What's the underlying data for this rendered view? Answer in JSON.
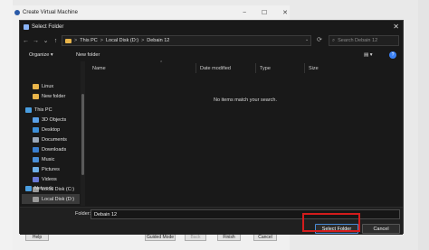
{
  "vm_window": {
    "title": "Create Virtual Machine",
    "min_glyph": "−",
    "max_glyph": "☐",
    "close_glyph": "✕",
    "buttons": {
      "help": "Help",
      "guided_mode": "Guided Mode",
      "back": "Back",
      "finish": "Finish",
      "cancel": "Cancel"
    }
  },
  "dialog": {
    "title": "Select Folder",
    "close_glyph": "✕",
    "nav": {
      "back": "←",
      "forward": "→",
      "dropdown": "⌄",
      "up": "↑",
      "refresh": "⟳"
    },
    "breadcrumb": [
      "This PC",
      "Local Disk (D:)",
      "Debain 12"
    ],
    "breadcrumb_sep": ">",
    "search_placeholder": "Search Debain 12",
    "search_glyph": "⌕",
    "organize": "Organize ▾",
    "new_folder": "New folder",
    "view_glyph": "▤ ▾",
    "help_glyph": "?",
    "sidebar": [
      {
        "label": "Linux",
        "icon": "folder-icon",
        "color": "#e8b44a"
      },
      {
        "label": "New folder",
        "icon": "folder-icon",
        "color": "#e8b44a"
      },
      {
        "label": "This PC",
        "icon": "computer-icon",
        "color": "#4a9ee0"
      },
      {
        "label": "3D Objects",
        "icon": "cube-icon",
        "color": "#5aa0e6"
      },
      {
        "label": "Desktop",
        "icon": "desktop-icon",
        "color": "#3d8fd8"
      },
      {
        "label": "Documents",
        "icon": "documents-icon",
        "color": "#9aa7b8"
      },
      {
        "label": "Downloads",
        "icon": "download-icon",
        "color": "#3a7fd0"
      },
      {
        "label": "Music",
        "icon": "music-icon",
        "color": "#4a8fd8"
      },
      {
        "label": "Pictures",
        "icon": "pictures-icon",
        "color": "#6fb0e8"
      },
      {
        "label": "Videos",
        "icon": "videos-icon",
        "color": "#6a7ad8"
      },
      {
        "label": "Local Disk (C:)",
        "icon": "drive-icon",
        "color": "#9a9a9a"
      },
      {
        "label": "Local Disk (D:)",
        "icon": "drive-icon",
        "color": "#9a9a9a"
      },
      {
        "label": "Network",
        "icon": "network-icon",
        "color": "#4a9ee0"
      }
    ],
    "columns": [
      "Name",
      "Date modified",
      "Type",
      "Size"
    ],
    "sort_glyph": "⌃",
    "empty_message": "No items match your search.",
    "folder_label": "Folder:",
    "folder_value": "Debain 12",
    "select_button": "Select Folder",
    "cancel_button": "Cancel"
  },
  "colors": {
    "highlight": "#d31c1c",
    "accent": "#4a8bd6"
  }
}
